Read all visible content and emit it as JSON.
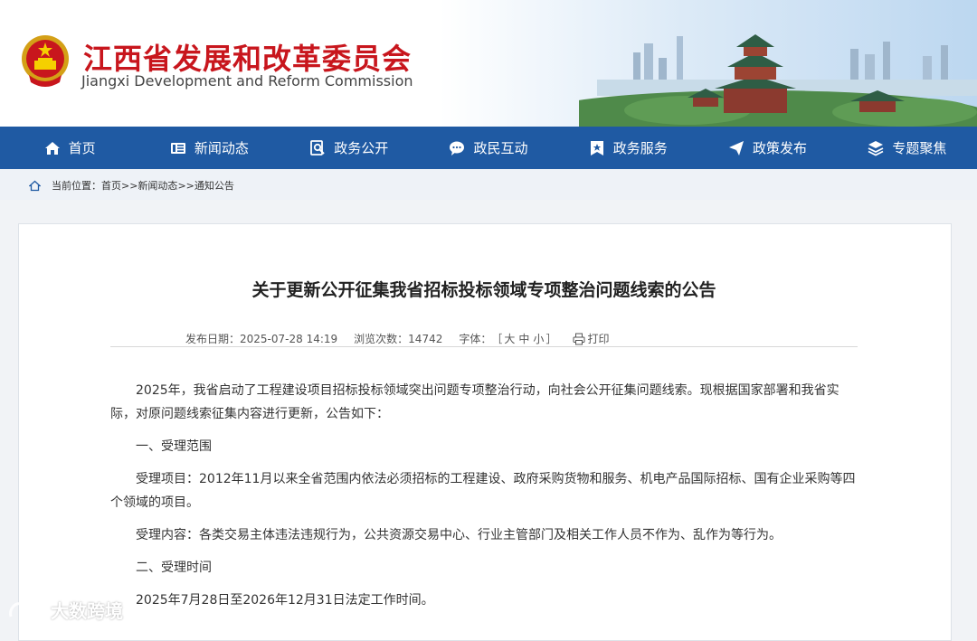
{
  "header": {
    "title_cn": "江西省发展和改革委员会",
    "title_en": "Jiangxi Development and Reform Commission"
  },
  "nav": [
    {
      "label": "首页",
      "icon": "home-icon"
    },
    {
      "label": "新闻动态",
      "icon": "news-icon"
    },
    {
      "label": "政务公开",
      "icon": "search-doc-icon"
    },
    {
      "label": "政民互动",
      "icon": "chat-icon"
    },
    {
      "label": "政务服务",
      "icon": "star-bookmark-icon"
    },
    {
      "label": "政策发布",
      "icon": "send-icon"
    },
    {
      "label": "专题聚焦",
      "icon": "layers-icon"
    }
  ],
  "breadcrumb": {
    "prefix": "当前位置：",
    "items": [
      "首页",
      "新闻动态",
      "通知公告"
    ],
    "separator": ">>"
  },
  "article": {
    "title": "关于更新公开征集我省招标投标领域专项整治问题线索的公告",
    "meta": {
      "date_label": "发布日期：",
      "date": "2025-07-28 14:19",
      "views_label": "浏览次数：",
      "views": "14742",
      "font_label": "字体：",
      "font_open": "［",
      "font_large": "大",
      "font_medium": "中",
      "font_small": "小",
      "font_close": "］",
      "print": "打印"
    },
    "paragraphs": [
      "2025年，我省启动了工程建设项目招标投标领域突出问题专项整治行动，向社会公开征集问题线索。现根据国家部署和我省实际，对原问题线索征集内容进行更新，公告如下：",
      "一、受理范围",
      "受理项目：2012年11月以来全省范围内依法必须招标的工程建设、政府采购货物和服务、机电产品国际招标、国有企业采购等四个领域的项目。",
      "受理内容：各类交易主体违法违规行为，公共资源交易中心、行业主管部门及相关工作人员不作为、乱作为等行为。",
      "二、受理时间",
      "2025年7月28日至2026年12月31日法定工作时间。"
    ]
  },
  "watermark": "大数跨境",
  "colors": {
    "nav_bg": "#1f5aa3",
    "title_red": "#c8161d",
    "page_bg": "#f1f3f6"
  }
}
